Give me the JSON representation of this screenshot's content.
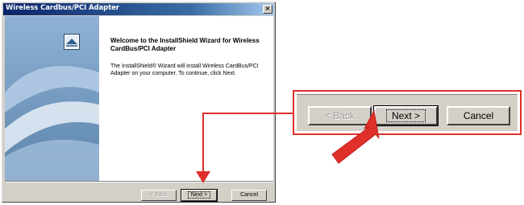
{
  "window": {
    "title": "Wireless Cardbus/PCI Adapter",
    "close_glyph": "×"
  },
  "wizard": {
    "heading": "Welcome to the InstallShield Wizard for Wireless CardBus/PCI Adapter",
    "body": "The InstallShield® Wizard will install Wireless CardBus/PCI Adapter on your computer.  To continue, click Next."
  },
  "buttons": {
    "back": "< Back",
    "next": "Next >",
    "cancel": "Cancel"
  },
  "callout": {
    "back": "< Back",
    "next": "Next >",
    "cancel": "Cancel"
  },
  "colors": {
    "callout_red": "#e0302a",
    "dialog_gray": "#d4d0c8"
  }
}
